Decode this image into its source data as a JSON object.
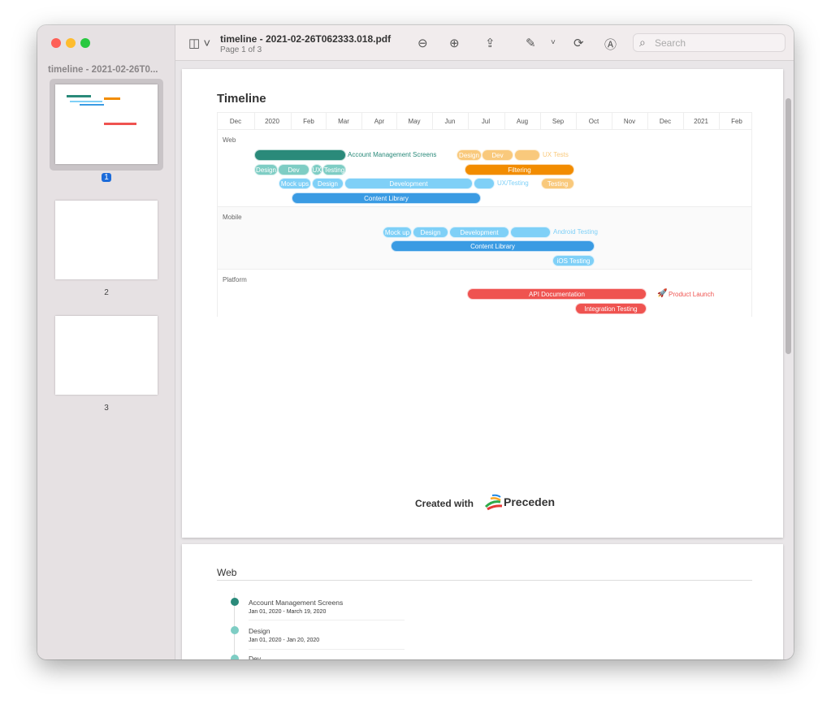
{
  "window": {
    "title": "timeline - 2021-02-26T062333.018.pdf",
    "subtitle": "Page 1 of 3",
    "search_placeholder": "Search"
  },
  "sidebar": {
    "title": "timeline - 2021-02-26T0...",
    "pages": [
      "1",
      "2",
      "3"
    ],
    "selected_page": "1"
  },
  "gantt": {
    "title": "Timeline",
    "months": [
      "Dec",
      "2020",
      "Feb",
      "Mar",
      "Apr",
      "May",
      "Jun",
      "Jul",
      "Aug",
      "Sep",
      "Oct",
      "Nov",
      "Dec",
      "2021",
      "Feb"
    ],
    "sections": [
      "Web",
      "Mobile",
      "Platform"
    ],
    "bars": [
      "",
      "Design",
      "Dev",
      "",
      "Design",
      "Dev",
      "UX",
      "Testing",
      "Filtering",
      "Mock ups",
      "Design",
      "Development",
      "",
      "Testing",
      "Content Library",
      "Mock up",
      "Design",
      "Development",
      "",
      "Content Library",
      "iOS Testing",
      "API Documentation",
      "Integration Testing"
    ],
    "labels": [
      "Account Management Screens",
      "UX Tests",
      "UX/Testing",
      "Android Testing",
      "Product Launch"
    ],
    "colors": {
      "teal_dark": "#2a8a7a",
      "teal_light": "#7ecdc4",
      "orange": "#f28c00",
      "orange_light": "#f9c97c",
      "blue": "#3a9be3",
      "blue_light": "#7fd0f7",
      "red": "#ef5350"
    }
  },
  "footer": {
    "credit": "Created with",
    "brand": "Preceden"
  },
  "page2": {
    "section": "Web",
    "items": [
      {
        "name": "Account Management Screens",
        "dates": "Jan 01, 2020 - March 19, 2020"
      },
      {
        "name": "Design",
        "dates": "Jan 01, 2020 - Jan 20, 2020"
      },
      {
        "name": "Dev",
        "dates": ""
      }
    ]
  }
}
